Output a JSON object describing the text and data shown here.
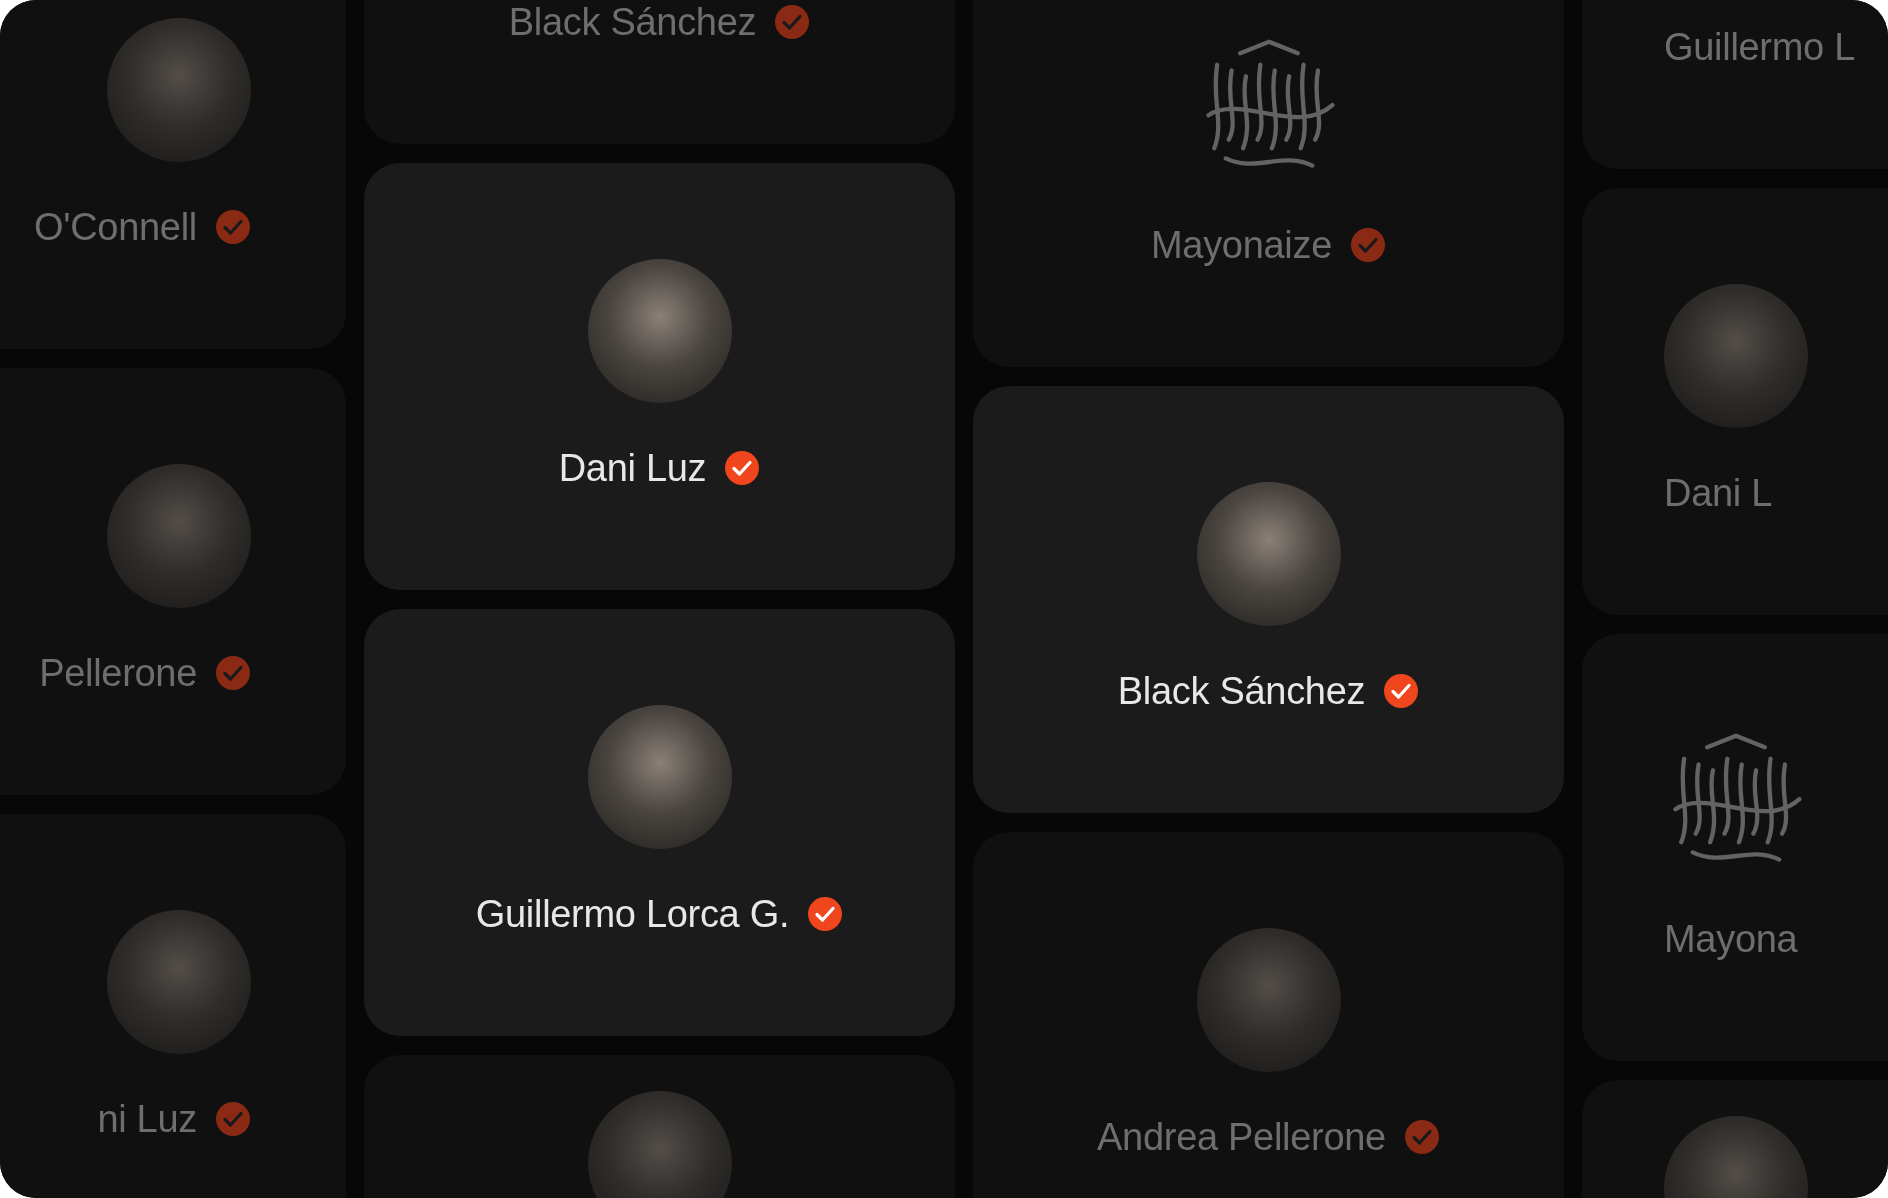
{
  "columns": [
    {
      "cards": [
        {
          "name": "O'Connell",
          "kind": "photo",
          "highlighted": false,
          "verified": true
        },
        {
          "name": "Pellerone",
          "kind": "photo",
          "highlighted": false,
          "verified": true
        },
        {
          "name": "ni Luz",
          "kind": "photo",
          "highlighted": false,
          "verified": true
        }
      ]
    },
    {
      "cards": [
        {
          "name": "Black Sánchez",
          "highlighted": false,
          "verified": true
        },
        {
          "name": "Dani Luz",
          "kind": "photo",
          "highlighted": true,
          "verified": true
        },
        {
          "name": "Guillermo Lorca G.",
          "kind": "photo",
          "highlighted": true,
          "verified": true
        },
        {
          "kind": "photo",
          "highlighted": false
        }
      ]
    },
    {
      "cards": [
        {
          "name": "Mayonaize",
          "kind": "logo",
          "highlighted": false,
          "verified": true
        },
        {
          "name": "Black Sánchez",
          "kind": "photo",
          "highlighted": true,
          "verified": true
        },
        {
          "name": "Andrea Pellerone",
          "kind": "photo",
          "highlighted": false,
          "verified": true
        }
      ]
    },
    {
      "cards": [
        {
          "name": "Guillermo L",
          "highlighted": false
        },
        {
          "name": "Dani L",
          "kind": "photo",
          "highlighted": false
        },
        {
          "name": "Mayona",
          "kind": "logo",
          "highlighted": false
        },
        {
          "kind": "photo",
          "highlighted": false
        }
      ]
    }
  ]
}
